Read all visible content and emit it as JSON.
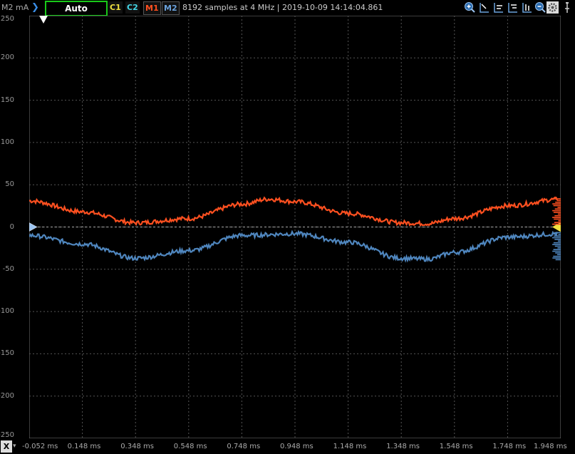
{
  "toolbar": {
    "y_unit": "M2 mA",
    "arrow": "❯",
    "auto_label": "Auto",
    "channels": [
      "C1",
      "C2",
      "M1",
      "M2"
    ],
    "status": "8192 samples at 4 MHz | 2019-10-09 14:14:04.861",
    "tools": [
      "zoom-in-icon",
      "cursor-icon",
      "cursor-align-left-icon",
      "cursor-align-right-icon",
      "cursor-bars-icon",
      "zoom-out-icon",
      "settings-icon",
      "pin-icon"
    ]
  },
  "y_axis": {
    "labels": [
      "250",
      "200",
      "150",
      "100",
      "50",
      "0",
      "-50",
      "-100",
      "-150",
      "-200",
      "-250"
    ],
    "min": -250,
    "max": 250
  },
  "x_axis": {
    "button": "X",
    "labels": [
      "-0.052 ms",
      "0.148 ms",
      "0.348 ms",
      "0.548 ms",
      "0.748 ms",
      "0.948 ms",
      "1.148 ms",
      "1.348 ms",
      "1.548 ms",
      "1.748 ms",
      "1.948 ms"
    ]
  },
  "colors": {
    "m1": "#ff5020",
    "m2": "#4f86be",
    "grid": "#555555",
    "accent": "#19c919"
  },
  "chart_data": {
    "type": "line",
    "x_unit": "ms",
    "y_unit": "mA",
    "xlim": [
      -0.052,
      1.948
    ],
    "ylim": [
      -250,
      250
    ],
    "series": [
      {
        "name": "M1",
        "x": [
          -0.052,
          0.148,
          0.348,
          0.548,
          0.748,
          0.848,
          0.948,
          1.148,
          1.348,
          1.448,
          1.548,
          1.748,
          1.948
        ],
        "values": [
          31,
          18,
          5,
          10,
          27,
          33,
          30,
          16,
          5,
          4,
          10,
          25,
          33
        ]
      },
      {
        "name": "M2",
        "x": [
          -0.052,
          0.148,
          0.348,
          0.548,
          0.748,
          0.948,
          1.148,
          1.348,
          1.448,
          1.548,
          1.748,
          1.948
        ],
        "values": [
          -10,
          -20,
          -37,
          -28,
          -10,
          -8,
          -18,
          -37,
          -38,
          -30,
          -12,
          -8
        ]
      }
    ]
  }
}
